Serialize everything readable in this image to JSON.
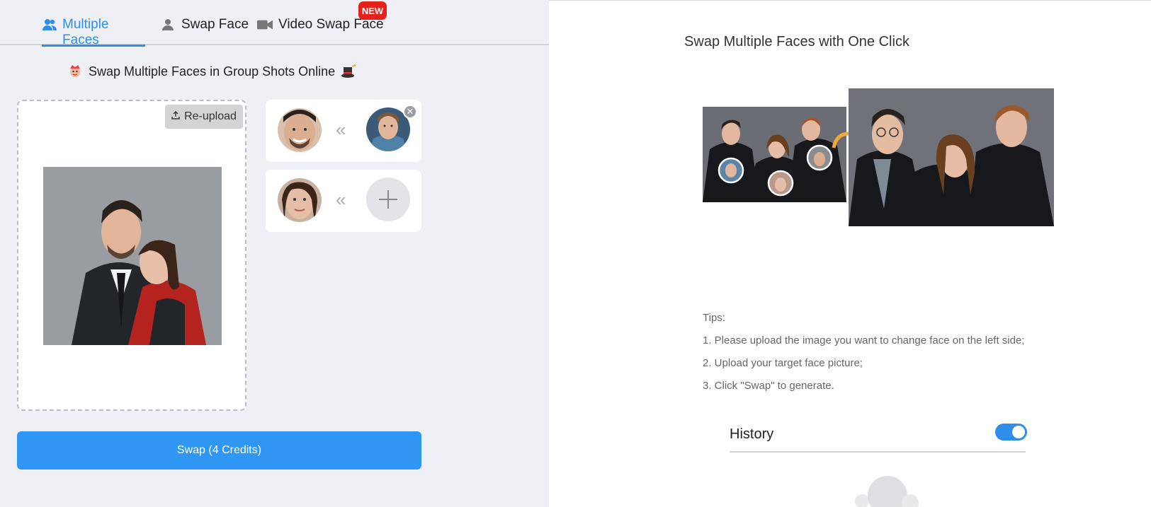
{
  "tabs": [
    {
      "label": "Multiple Faces",
      "icon": "users-icon",
      "active": true
    },
    {
      "label": "Swap Face",
      "icon": "user-icon",
      "active": false
    },
    {
      "label": "Video Swap Face",
      "icon": "video-camera-icon",
      "active": false
    }
  ],
  "new_badge": "NEW",
  "subtitle": "Swap Multiple Faces in Group Shots Online",
  "upload": {
    "reupload_label": "Re-upload"
  },
  "face_pairs": [
    {
      "arrow": "«",
      "has_target": true
    },
    {
      "arrow": "«",
      "has_target": false
    }
  ],
  "swap_button": "Swap (4 Credits)",
  "right": {
    "title": "Swap Multiple Faces with One Click",
    "tips_heading": "Tips:",
    "tips": [
      "1. Please upload the image you want to change face on the left side;",
      "2. Upload your target face picture;",
      "3. Click \"Swap\" to generate."
    ],
    "history_label": "History",
    "history_enabled": true
  },
  "colors": {
    "accent": "#2f8fe8",
    "badge": "#e6201a",
    "button": "#2f96f3"
  }
}
